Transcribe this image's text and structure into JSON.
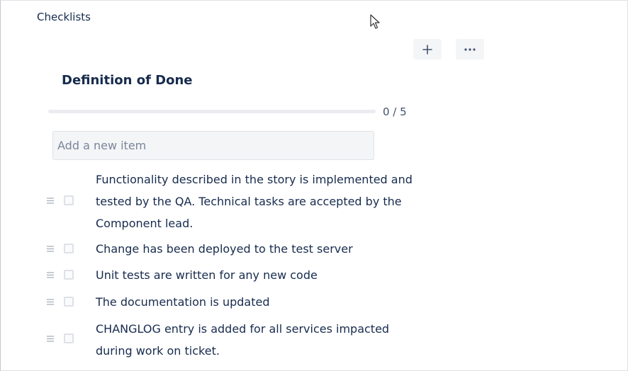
{
  "section": {
    "title": "Checklists"
  },
  "toolbar": {
    "add_icon": "plus-icon",
    "more_icon": "ellipsis-icon"
  },
  "checklist": {
    "title": "Definition of Done",
    "progress_text": "0 / 5",
    "progress_fraction": 0,
    "new_item_placeholder": "Add a new item",
    "items": [
      {
        "text": "Functionality described in the story is implemented and tested by the QA. Technical tasks are accepted by the Component lead.",
        "checked": false
      },
      {
        "text": "Change has been deployed to the test server",
        "checked": false
      },
      {
        "text": "Unit tests are written for any new code",
        "checked": false
      },
      {
        "text": "The documentation is updated",
        "checked": false
      },
      {
        "text": "CHANGLOG entry is added for all services impacted during work on ticket.",
        "checked": false
      }
    ]
  },
  "colors": {
    "text": "#172b4d",
    "muted": "#42526e",
    "button_bg": "#f4f5f7",
    "border": "#dfe1e6"
  }
}
